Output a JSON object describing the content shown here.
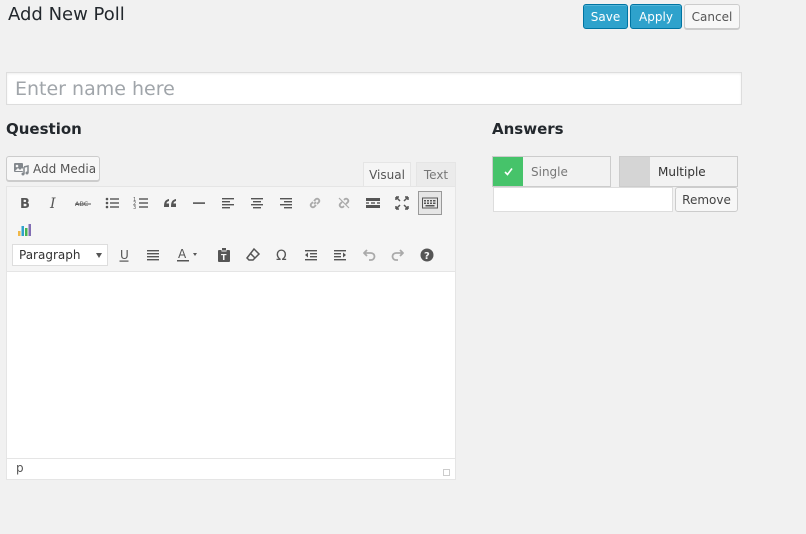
{
  "page": {
    "title": "Add New Poll"
  },
  "actions": {
    "save_label": "Save",
    "apply_label": "Apply",
    "cancel_label": "Cancel"
  },
  "name_field": {
    "placeholder": "Enter name here",
    "value": ""
  },
  "question": {
    "heading": "Question",
    "add_media_label": "Add Media",
    "tabs": {
      "visual": "Visual",
      "text": "Text"
    },
    "format_select": {
      "selected": "Paragraph"
    },
    "status_path": "p",
    "body": ""
  },
  "answers": {
    "heading": "Answers",
    "single_label": "Single",
    "multiple_label": "Multiple",
    "single_selected": true,
    "answer_value": "",
    "remove_label": "Remove"
  },
  "colors": {
    "primary": "#2ea2cc",
    "toggle_on": "#46c36a",
    "toggle_off": "#d5d5d5"
  }
}
